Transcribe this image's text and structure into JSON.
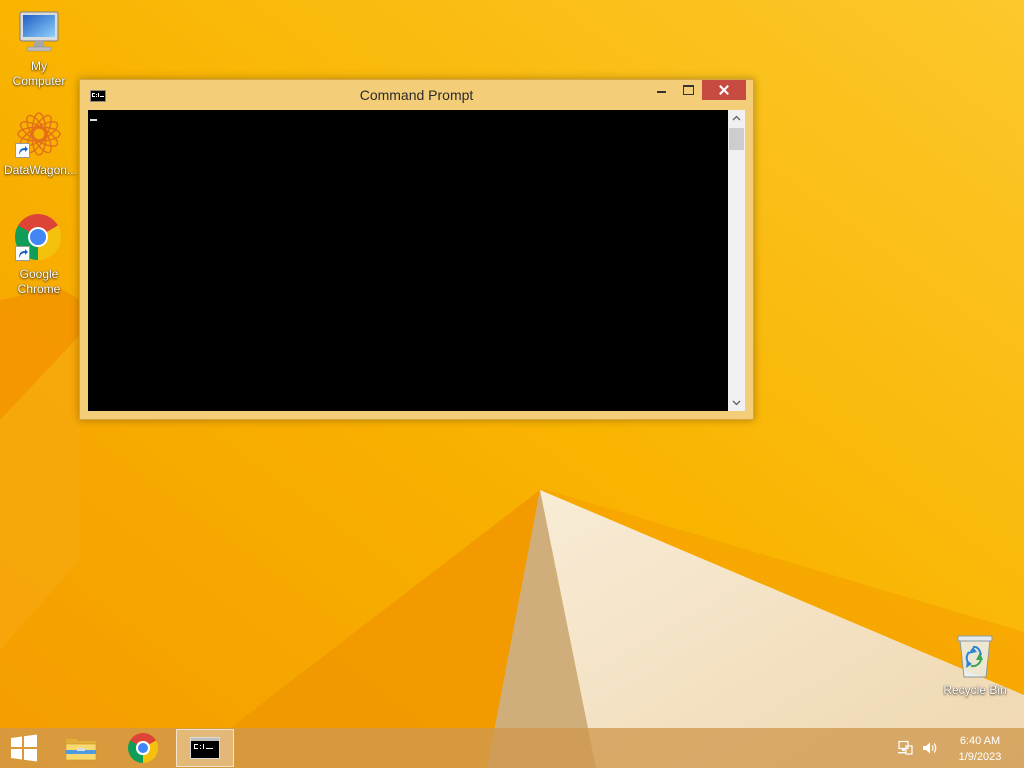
{
  "desktop": {
    "icons": [
      {
        "label": "My Computer",
        "icon": "my-computer-icon"
      },
      {
        "label": "DataWagon...",
        "icon": "datawagon-icon",
        "shortcut": true
      },
      {
        "label": "Google Chrome",
        "icon": "chrome-icon",
        "shortcut": true
      },
      {
        "label": "Recycle Bin",
        "icon": "recycle-bin-icon"
      }
    ]
  },
  "window": {
    "title": "Command Prompt",
    "icon": "command-prompt-icon",
    "controls": [
      "minimize-icon",
      "maximize-icon",
      "close-icon"
    ]
  },
  "taskbar": {
    "start_icon": "windows-logo-icon",
    "items": [
      {
        "icon": "file-explorer-icon",
        "active": false
      },
      {
        "icon": "chrome-icon",
        "active": false
      },
      {
        "icon": "command-prompt-icon",
        "active": true
      }
    ],
    "tray": {
      "icons": [
        "network-icon",
        "volume-icon"
      ],
      "time": "6:40 AM",
      "date": "1/9/2023"
    }
  },
  "colors": {
    "wallpaper": "#f8b400",
    "window_frame": "#f3cd77",
    "close_button": "#c74b41",
    "console_background": "#000000"
  }
}
